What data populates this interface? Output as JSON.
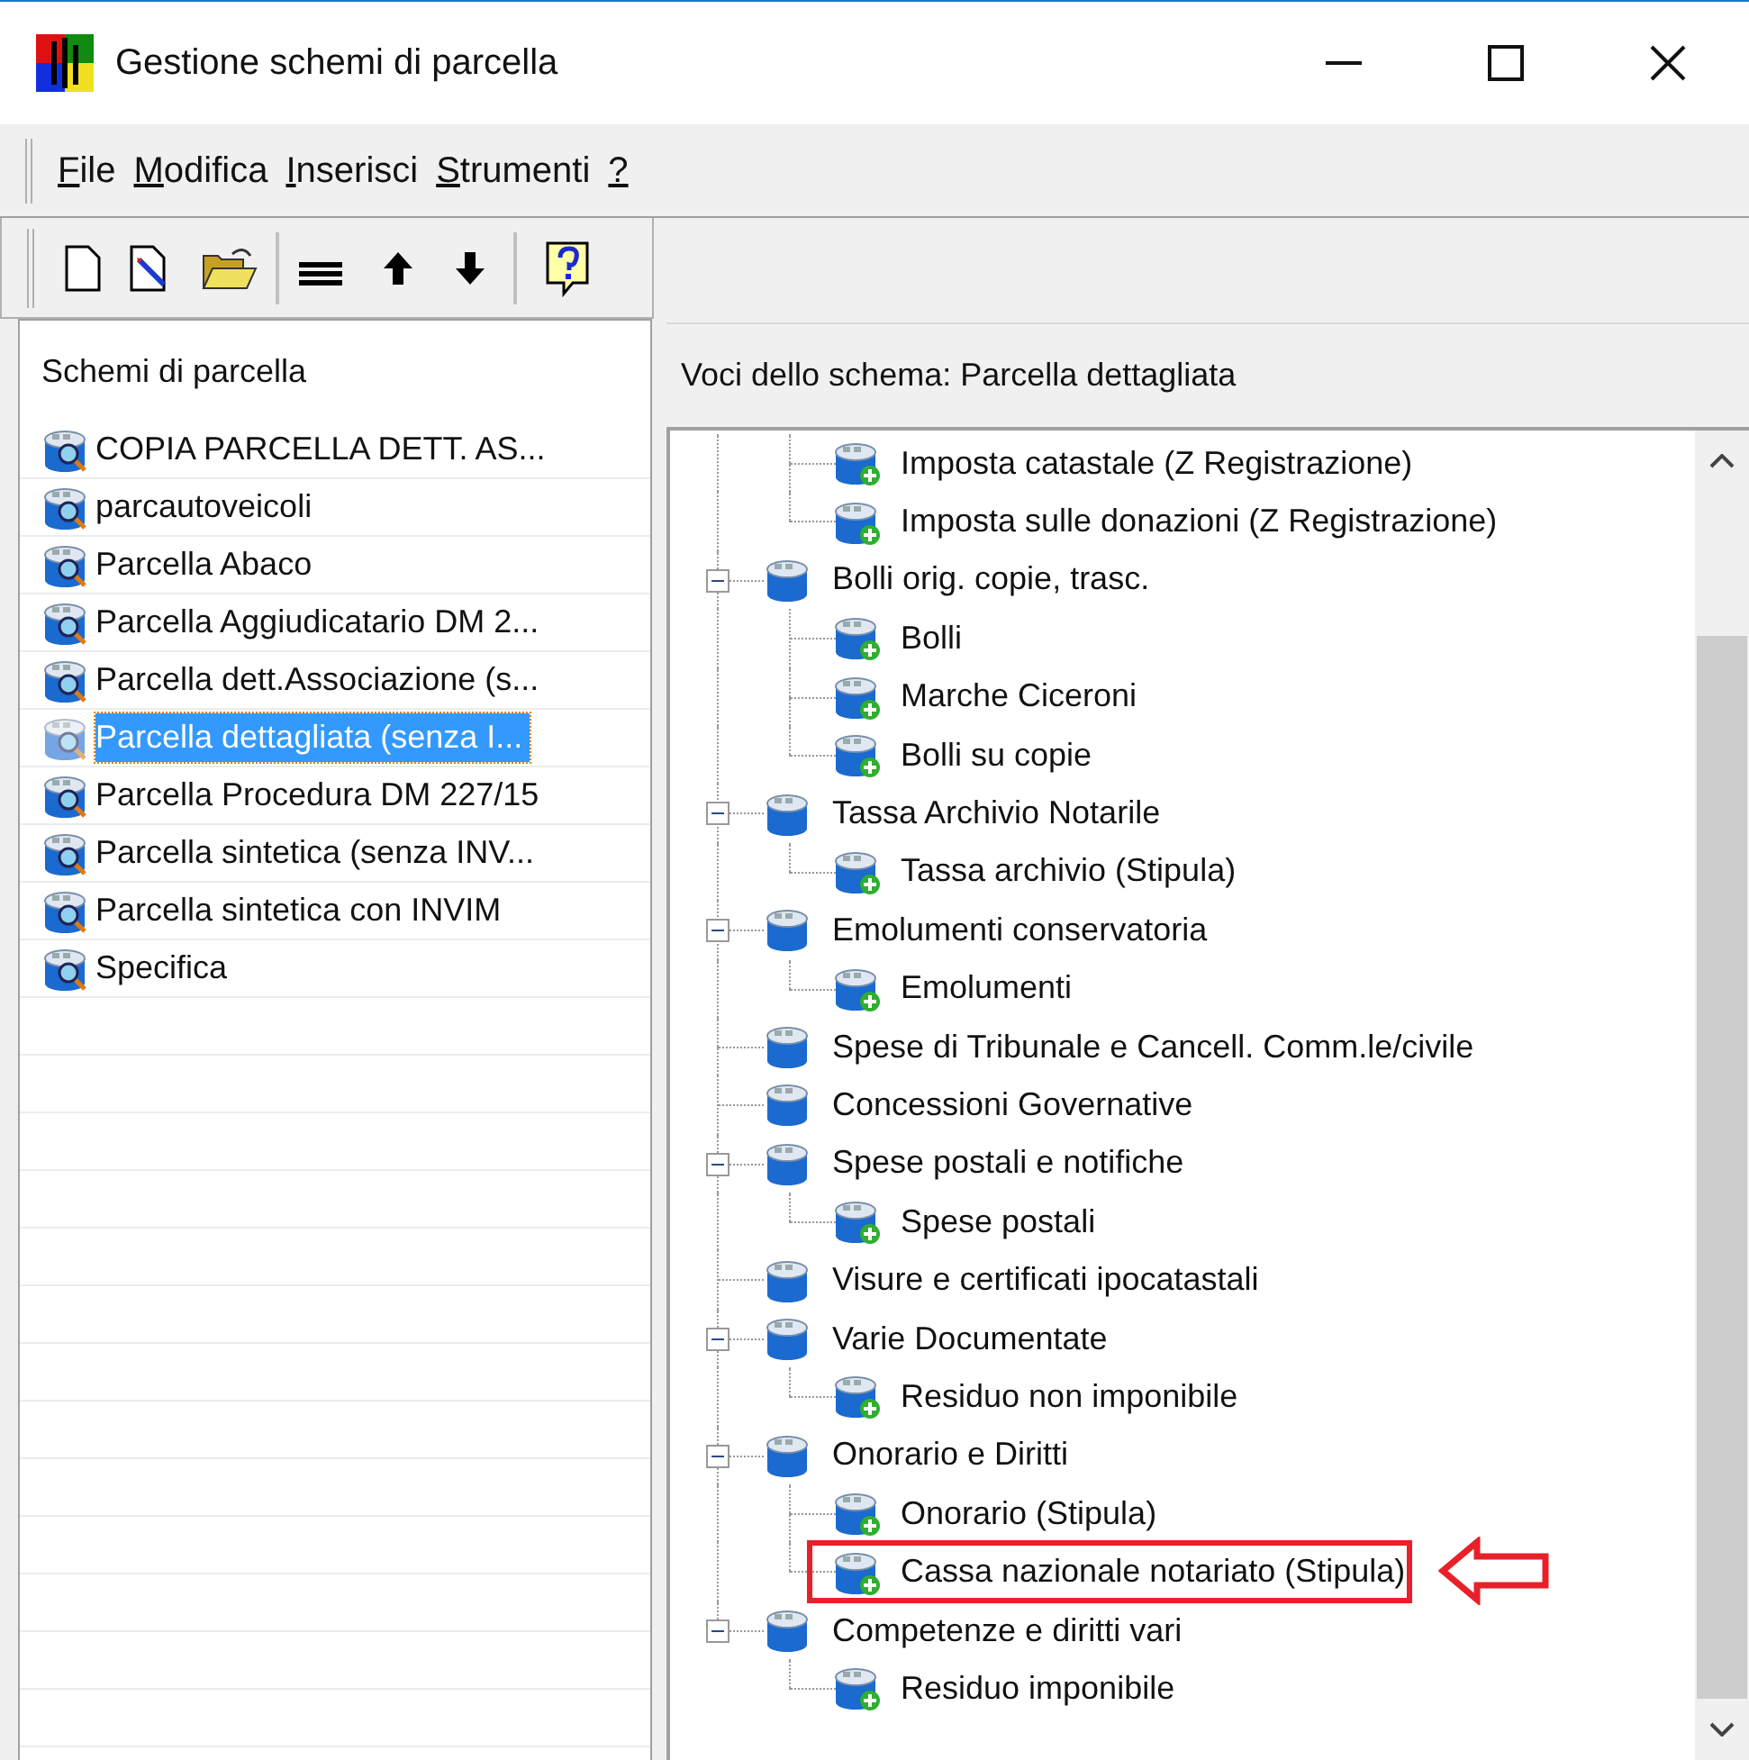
{
  "window": {
    "title": "Gestione schemi di parcella"
  },
  "menu": [
    "File",
    "Modifica",
    "Inserisci",
    "Strumenti",
    "?"
  ],
  "schemes_panel": {
    "title": "Schemi di parcella",
    "items": [
      {
        "label": "COPIA PARCELLA DETT. AS...",
        "selected": false
      },
      {
        "label": "parcautoveicoli",
        "selected": false
      },
      {
        "label": "Parcella Abaco",
        "selected": false
      },
      {
        "label": "Parcella Aggiudicatario DM 2...",
        "selected": false
      },
      {
        "label": "Parcella dett.Associazione (s...",
        "selected": false
      },
      {
        "label": "Parcella dettagliata (senza I...",
        "selected": true
      },
      {
        "label": "Parcella Procedura DM 227/15",
        "selected": false
      },
      {
        "label": "Parcella sintetica (senza INV...",
        "selected": false
      },
      {
        "label": "Parcella sintetica con INVIM",
        "selected": false
      },
      {
        "label": "Specifica",
        "selected": false
      }
    ]
  },
  "items_panel": {
    "title": "Voci dello schema: Parcella dettagliata",
    "tree": [
      {
        "children": [
          {
            "label": "Imposta catastale (Z Registrazione)",
            "highlighted": false
          },
          {
            "label": "Imposta sulle donazioni (Z Registrazione)",
            "highlighted": false
          }
        ]
      },
      {
        "label": "Bolli orig. copie, trasc.",
        "expanded": true,
        "children": [
          {
            "label": "Bolli",
            "highlighted": false
          },
          {
            "label": "Marche Ciceroni",
            "highlighted": false
          },
          {
            "label": "Bolli su copie",
            "highlighted": false
          }
        ]
      },
      {
        "label": "Tassa Archivio Notarile",
        "expanded": true,
        "children": [
          {
            "label": "Tassa archivio (Stipula)",
            "highlighted": false
          }
        ]
      },
      {
        "label": "Emolumenti conservatoria",
        "expanded": true,
        "children": [
          {
            "label": "Emolumenti",
            "highlighted": false
          }
        ]
      },
      {
        "label": "Spese di Tribunale e Cancell. Comm.le/civile"
      },
      {
        "label": "Concessioni Governative"
      },
      {
        "label": "Spese postali e notifiche",
        "expanded": true,
        "children": [
          {
            "label": "Spese postali",
            "highlighted": false
          }
        ]
      },
      {
        "label": "Visure e certificati ipocatastali"
      },
      {
        "label": "Varie Documentate",
        "expanded": true,
        "children": [
          {
            "label": "Residuo non imponibile",
            "highlighted": false
          }
        ]
      },
      {
        "label": "Onorario e Diritti",
        "expanded": true,
        "children": [
          {
            "label": "Onorario (Stipula)",
            "highlighted": false
          },
          {
            "label": "Cassa nazionale notariato (Stipula)",
            "highlighted": true
          }
        ]
      },
      {
        "label": "Competenze e diritti vari",
        "expanded": true,
        "children": [
          {
            "label": "Residuo imponibile",
            "highlighted": false
          }
        ]
      }
    ]
  }
}
